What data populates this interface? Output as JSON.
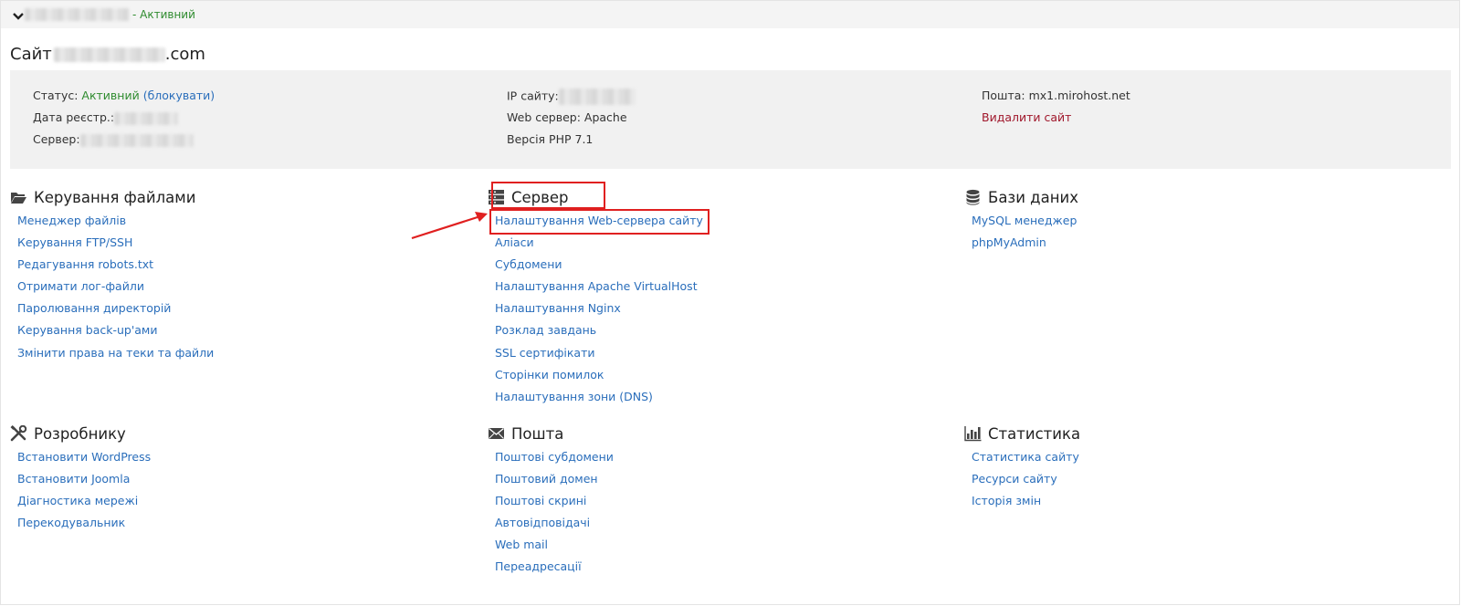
{
  "header": {
    "status_text": "- Активний"
  },
  "site": {
    "title_prefix": "Сайт",
    "title_suffix": ".com"
  },
  "info": {
    "status_label": "Статус:",
    "status_value": "Активний",
    "block_link": "(блокувати)",
    "reg_label": "Дата реєстр.:",
    "server_label": "Сервер:",
    "ip_label": "IP сайту:",
    "web_server": "Web сервер: Apache",
    "php_version": "Версія PHP 7.1",
    "mail": "Пошта: mx1.mirohost.net",
    "delete_link": "Видалити сайт"
  },
  "sections": {
    "files": {
      "title": "Керування файлами",
      "icon": "folder-open-icon",
      "items": [
        "Менеджер файлів",
        "Керування FTP/SSH",
        "Редагування robots.txt",
        "Отримати лог-файли",
        "Паролювання директорій",
        "Керування back-up'ами",
        "Змінити права на теки та файли"
      ]
    },
    "server": {
      "title": "Сервер",
      "icon": "server-icon",
      "items": [
        "Налаштування Web-сервера сайту",
        "Аліаси",
        "Субдомени",
        "Налаштування Apache VirtualHost",
        "Налаштування Nginx",
        "Розклад завдань",
        "SSL сертифікати",
        "Сторінки помилок",
        "Налаштування зони (DNS)"
      ]
    },
    "databases": {
      "title": "Бази даних",
      "icon": "database-icon",
      "items": [
        "MySQL менеджер",
        "phpMyAdmin"
      ]
    },
    "developer": {
      "title": "Розробнику",
      "icon": "tools-icon",
      "items": [
        "Встановити WordPress",
        "Встановити Joomla",
        "Діагностика мережі",
        "Перекодувальник"
      ]
    },
    "mail": {
      "title": "Пошта",
      "icon": "envelope-icon",
      "items": [
        "Поштові субдомени",
        "Поштовий домен",
        "Поштові скрині",
        "Автовідповідачі",
        "Web mail",
        "Переадресації"
      ]
    },
    "stats": {
      "title": "Статистика",
      "icon": "bar-chart-icon",
      "items": [
        "Статистика сайту",
        "Ресурси сайту",
        "Історія змін"
      ]
    }
  },
  "colors": {
    "link": "#2a6ebb",
    "active": "#2e8b2e",
    "danger": "#a0172b",
    "annotation": "#e02020"
  }
}
